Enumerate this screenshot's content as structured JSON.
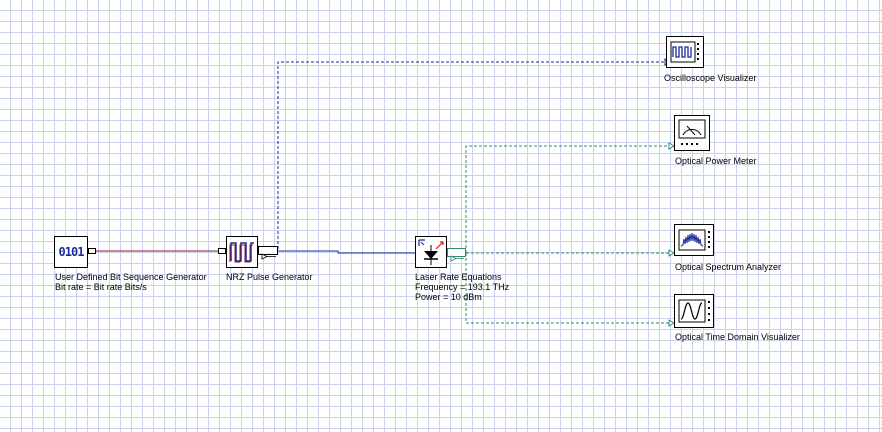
{
  "components": {
    "bitgen": {
      "icon_text": "0101",
      "name": "User Defined Bit Sequence Generator",
      "param": "Bit rate = Bit rate  Bits/s"
    },
    "nrz": {
      "name": "NRZ Pulse Generator"
    },
    "laser": {
      "name": "Laser Rate Equations",
      "param1": "Frequency = 193.1  THz",
      "param2": "Power = 10  dBm"
    },
    "osc": {
      "name": "Oscilloscope Visualizer"
    },
    "opm": {
      "name": "Optical Power Meter"
    },
    "osa": {
      "name": "Optical Spectrum Analyzer"
    },
    "otdv": {
      "name": "Optical Time Domain Visualizer"
    }
  },
  "colors": {
    "grid": "#c9d3ee",
    "electrical_wire": "#1a2a9c",
    "bit_wire": "#8b1a2a",
    "optical_wire": "#2e8b6e"
  }
}
